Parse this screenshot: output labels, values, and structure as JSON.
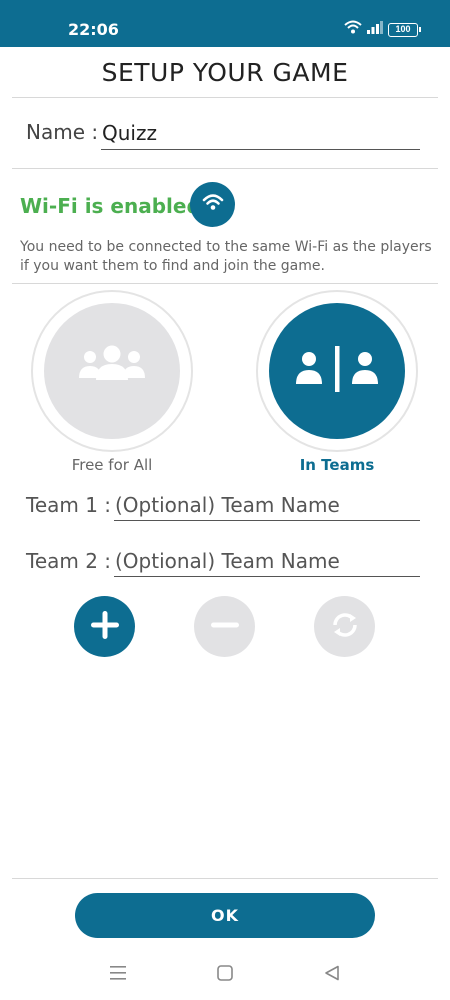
{
  "status_bar": {
    "time": "22:06",
    "battery": "100"
  },
  "page": {
    "title": "SETUP YOUR GAME"
  },
  "name_field": {
    "label": "Name :",
    "value": "Quizz"
  },
  "wifi": {
    "status": "Wi-Fi is enabled",
    "status_color": "#4caf50",
    "note": "You need to be connected to the same Wi-Fi as the players if you want them to find and join the game."
  },
  "modes": [
    {
      "label": "Free for All",
      "selected": false,
      "icon": "group-icon"
    },
    {
      "label": "In Teams",
      "selected": true,
      "icon": "teams-icon"
    }
  ],
  "teams": [
    {
      "label": "Team 1 :",
      "placeholder": "(Optional) Team Name",
      "value": ""
    },
    {
      "label": "Team 2 :",
      "placeholder": "(Optional) Team Name",
      "value": ""
    }
  ],
  "team_actions": [
    {
      "icon": "plus-icon",
      "enabled": true
    },
    {
      "icon": "minus-icon",
      "enabled": false
    },
    {
      "icon": "shuffle-icon",
      "enabled": false
    }
  ],
  "ok_button": {
    "label": "OK"
  },
  "colors": {
    "accent": "#0d6d91",
    "disabled": "#e2e2e4",
    "wifi_ok": "#4caf50"
  },
  "nav_bar": [
    "menu-icon",
    "home-icon",
    "back-icon"
  ]
}
